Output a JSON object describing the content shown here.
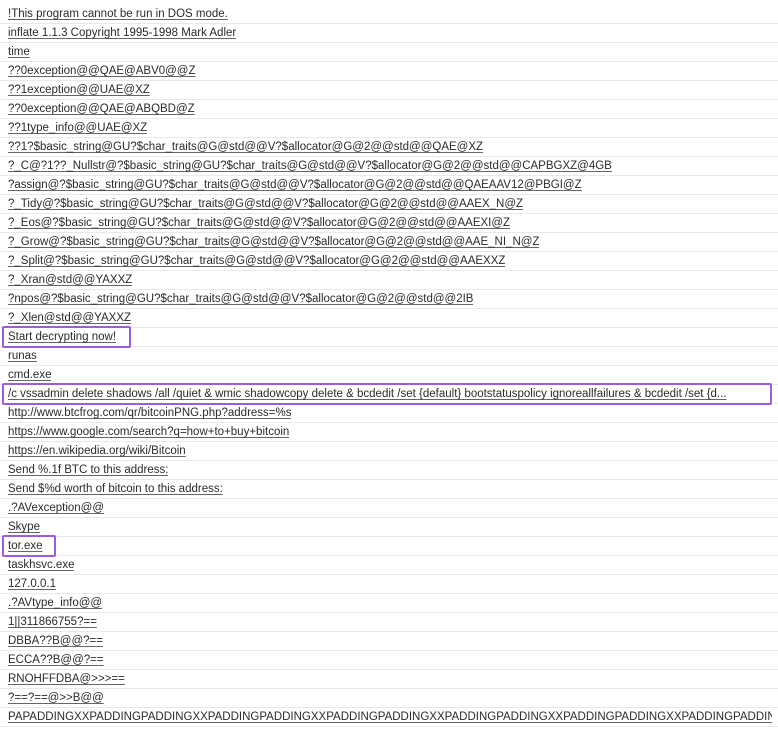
{
  "strings": [
    {
      "text": "!This program cannot be run in DOS mode."
    },
    {
      "text": " inflate 1.1.3 Copyright 1995-1998 Mark Adler "
    },
    {
      "text": "time"
    },
    {
      "text": "??0exception@@QAE@ABV0@@Z"
    },
    {
      "text": "??1exception@@UAE@XZ"
    },
    {
      "text": "??0exception@@QAE@ABQBD@Z"
    },
    {
      "text": "??1type_info@@UAE@XZ"
    },
    {
      "text": "??1?$basic_string@GU?$char_traits@G@std@@V?$allocator@G@2@@std@@QAE@XZ"
    },
    {
      "text": "?_C@?1??_Nullstr@?$basic_string@GU?$char_traits@G@std@@V?$allocator@G@2@@std@@CAPBGXZ@4GB"
    },
    {
      "text": "?assign@?$basic_string@GU?$char_traits@G@std@@V?$allocator@G@2@@std@@QAEAAV12@PBGI@Z"
    },
    {
      "text": "?_Tidy@?$basic_string@GU?$char_traits@G@std@@V?$allocator@G@2@@std@@AAEX_N@Z"
    },
    {
      "text": "?_Eos@?$basic_string@GU?$char_traits@G@std@@V?$allocator@G@2@@std@@AAEXI@Z"
    },
    {
      "text": "?_Grow@?$basic_string@GU?$char_traits@G@std@@V?$allocator@G@2@@std@@AAE_NI_N@Z"
    },
    {
      "text": "?_Split@?$basic_string@GU?$char_traits@G@std@@V?$allocator@G@2@@std@@AAEXXZ"
    },
    {
      "text": "?_Xran@std@@YAXXZ"
    },
    {
      "text": "?npos@?$basic_string@GU?$char_traits@G@std@@V?$allocator@G@2@@std@@2IB"
    },
    {
      "text": "?_Xlen@std@@YAXXZ"
    },
    {
      "text": "Start decrypting now!",
      "highlighted": true
    },
    {
      "text": "runas"
    },
    {
      "text": "cmd.exe"
    },
    {
      "text": "/c vssadmin delete shadows /all /quiet & wmic shadowcopy delete & bcdedit /set {default} bootstatuspolicy ignoreallfailures & bcdedit /set {d...",
      "highlighted": true
    },
    {
      "text": "http://www.btcfrog.com/qr/bitcoinPNG.php?address=%s"
    },
    {
      "text": "https://www.google.com/search?q=how+to+buy+bitcoin"
    },
    {
      "text": "https://en.wikipedia.org/wiki/Bitcoin"
    },
    {
      "text": "Send %.1f BTC to this address:"
    },
    {
      "text": "Send $%d worth of bitcoin to this address:"
    },
    {
      "text": ".?AVexception@@"
    },
    {
      "text": "Skype"
    },
    {
      "text": "tor.exe",
      "highlighted": true
    },
    {
      "text": "taskhsvc.exe"
    },
    {
      "text": "127.0.0.1"
    },
    {
      "text": ".?AVtype_info@@"
    },
    {
      "text": "1||311866755?=="
    },
    {
      "text": "DBBA??B@@?=="
    },
    {
      "text": "ECCA??B@@?=="
    },
    {
      "text": "RNOHFFDBA@>>>=="
    },
    {
      "text": "?==?==@>>B@@"
    },
    {
      "text": "PAPADDINGXXPADDINGPADDINGXXPADDINGPADDINGXXPADDINGPADDINGXXPADDINGPADDINGXXPADDINGPADDINGXXPADDINGPADDINGX..."
    }
  ],
  "colors": {
    "highlight": "#9b5ce0",
    "text": "#2b2b2b",
    "separator": "#e9e9e9"
  }
}
